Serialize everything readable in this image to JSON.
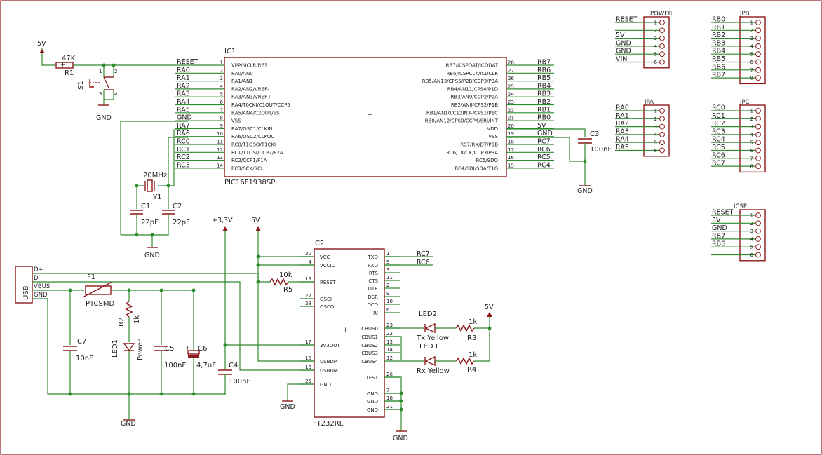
{
  "colors": {
    "wire": "#2e8b2e",
    "symbol": "#8b1a1a",
    "frame": "#8b1a1a",
    "text": "#202020"
  },
  "ic1": {
    "name": "IC1",
    "part": "PIC16F1938SP",
    "left_pins": [
      {
        "num": "1",
        "fn": "VPP/MCLR/RE3",
        "net": "RESET"
      },
      {
        "num": "2",
        "fn": "RA0/AN0",
        "net": "RA0"
      },
      {
        "num": "3",
        "fn": "RA1/AN1",
        "net": "RA1"
      },
      {
        "num": "4",
        "fn": "RA2/AN2/VREF-",
        "net": "RA2"
      },
      {
        "num": "5",
        "fn": "RA3/AN3/VREF+",
        "net": "RA3"
      },
      {
        "num": "6",
        "fn": "RA4/T0CKI/C1OUT/CCP5",
        "net": "RA4"
      },
      {
        "num": "7",
        "fn": "RA5/AN4/C2OUT/SS",
        "net": "RA5"
      },
      {
        "num": "8",
        "fn": "VSS",
        "net": "GND"
      },
      {
        "num": "9",
        "fn": "RA7/OSC1/CLKIN",
        "net": "RA7"
      },
      {
        "num": "10",
        "fn": "RA6/OSC2/CLKOUT",
        "net": "RA6"
      },
      {
        "num": "11",
        "fn": "RC0/T1OSO/T1CKI",
        "net": "RC0"
      },
      {
        "num": "12",
        "fn": "RC1/T1OSI/CCP2/P2A",
        "net": "RC1"
      },
      {
        "num": "13",
        "fn": "RC2/CCP1/P1A",
        "net": "RC2"
      },
      {
        "num": "14",
        "fn": "RC3/SCK/SCL",
        "net": "RC3"
      }
    ],
    "right_pins": [
      {
        "num": "28",
        "fn": "RB7/ICSPDAT/ICDDAT",
        "net": "RB7"
      },
      {
        "num": "27",
        "fn": "RB6/ICSPCLK/ICDCLK",
        "net": "RB6"
      },
      {
        "num": "26",
        "fn": "RB5/AN13/CPS5/P2B/CCP3/P3A",
        "net": "RB5"
      },
      {
        "num": "25",
        "fn": "RB4/AN11/CPS4/P1D",
        "net": "RB4"
      },
      {
        "num": "24",
        "fn": "RB3/AN9/CCP2/P2A",
        "net": "RB3"
      },
      {
        "num": "23",
        "fn": "RB2/AN8/CPS2/P1B",
        "net": "RB2"
      },
      {
        "num": "22",
        "fn": "RB1/AN10/C12IN3-/CPS1/P1C",
        "net": "RB1"
      },
      {
        "num": "21",
        "fn": "RB0/AN12/CPS0/CCP4/SRI/INT",
        "net": "RB0"
      },
      {
        "num": "20",
        "fn": "VDD",
        "net": "5V"
      },
      {
        "num": "19",
        "fn": "VSS",
        "net": "GND"
      },
      {
        "num": "18",
        "fn": "RC7/RX/DT/P3B",
        "net": "RC7"
      },
      {
        "num": "17",
        "fn": "RC6/TX/CK/CCP3/P3A",
        "net": "RC6"
      },
      {
        "num": "16",
        "fn": "RC5/SDO",
        "net": "RC5"
      },
      {
        "num": "15",
        "fn": "RC4/SDI/SDA/T1G",
        "net": "RC4"
      }
    ]
  },
  "ic2": {
    "name": "IC2",
    "part": "FT232RL",
    "left_pins": [
      {
        "num": "20",
        "fn": "VCC"
      },
      {
        "num": "4",
        "fn": "VCCIO"
      },
      {
        "num": "19",
        "fn": "RESET"
      },
      {
        "num": "27",
        "fn": "OSCI"
      },
      {
        "num": "28",
        "fn": "OSCO"
      },
      {
        "num": "17",
        "fn": "3V3OUT"
      },
      {
        "num": "15",
        "fn": "USBDP"
      },
      {
        "num": "16",
        "fn": "USBDM"
      },
      {
        "num": "25",
        "fn": "GND"
      }
    ],
    "right_pins": [
      {
        "num": "1",
        "fn": "TXD",
        "net": "RC7"
      },
      {
        "num": "5",
        "fn": "RXD",
        "net": "RC6"
      },
      {
        "num": "3",
        "fn": "RTS"
      },
      {
        "num": "11",
        "fn": "CTS"
      },
      {
        "num": "2",
        "fn": "DTR"
      },
      {
        "num": "9",
        "fn": "DSR"
      },
      {
        "num": "10",
        "fn": "DCD"
      },
      {
        "num": "6",
        "fn": "RI"
      },
      {
        "num": "23",
        "fn": "CBUS0"
      },
      {
        "num": "22",
        "fn": "CBUS1"
      },
      {
        "num": "13",
        "fn": "CBUS2"
      },
      {
        "num": "14",
        "fn": "CBUS3"
      },
      {
        "num": "12",
        "fn": "CBUS4"
      },
      {
        "num": "26",
        "fn": "TEST"
      },
      {
        "num": "7",
        "fn": "GND"
      },
      {
        "num": "18",
        "fn": "GND"
      },
      {
        "num": "21",
        "fn": "GND"
      }
    ]
  },
  "headers": [
    {
      "name": "POWER",
      "nets": [
        "RESET",
        "",
        "5V",
        "GND",
        "GND",
        "VIN"
      ]
    },
    {
      "name": "JPB",
      "nets": [
        "RB0",
        "RB1",
        "RB2",
        "RB3",
        "RB4",
        "RB5",
        "RB6",
        "RB7"
      ]
    },
    {
      "name": "JPA",
      "nets": [
        "RA0",
        "RA1",
        "RA2",
        "RA3",
        "RA4",
        "RA5"
      ]
    },
    {
      "name": "JPC",
      "nets": [
        "RC0",
        "RC1",
        "RC2",
        "RC3",
        "RC4",
        "RC5",
        "RC6",
        "RC7"
      ]
    },
    {
      "name": "ICSP",
      "nets": [
        "RESET",
        "5V",
        "GND",
        "RB7",
        "RB6",
        ""
      ]
    }
  ],
  "components": {
    "r1": {
      "name": "R1",
      "value": "47K"
    },
    "s1": {
      "name": "S1",
      "p1": "1",
      "p2": "2",
      "p3": "3",
      "p4": "4"
    },
    "y1": {
      "name": "Y1",
      "value": "20MHz"
    },
    "c1": {
      "name": "C1",
      "value": "22pF"
    },
    "c2": {
      "name": "C2",
      "value": "22pF"
    },
    "c3": {
      "name": "C3",
      "value": "100nF"
    },
    "usb": {
      "name": "USB",
      "pins": [
        "D+",
        "D-",
        "VBUS",
        "GND"
      ]
    },
    "f1": {
      "name": "F1",
      "value": "PTCSMD"
    },
    "c7": {
      "name": "C7",
      "value": "10nF"
    },
    "r2": {
      "name": "R2",
      "value": "1k"
    },
    "led1": {
      "name": "LED1",
      "value": "Power"
    },
    "c5": {
      "name": "C5",
      "value": "100nF"
    },
    "c6": {
      "name": "C6",
      "value": "4,7uF"
    },
    "c4": {
      "name": "C4",
      "value": "100nF"
    },
    "r5": {
      "name": "R5",
      "value": "10k"
    },
    "led2": {
      "name": "LED2",
      "value": "Tx Yellow"
    },
    "led3": {
      "name": "LED3",
      "value": "Rx Yellow"
    },
    "r3": {
      "name": "R3",
      "value": "1k"
    },
    "r4": {
      "name": "R4",
      "value": "1k"
    }
  },
  "supplies": {
    "v5": "5V",
    "v33": "+3,3V",
    "gnd": "GND"
  }
}
